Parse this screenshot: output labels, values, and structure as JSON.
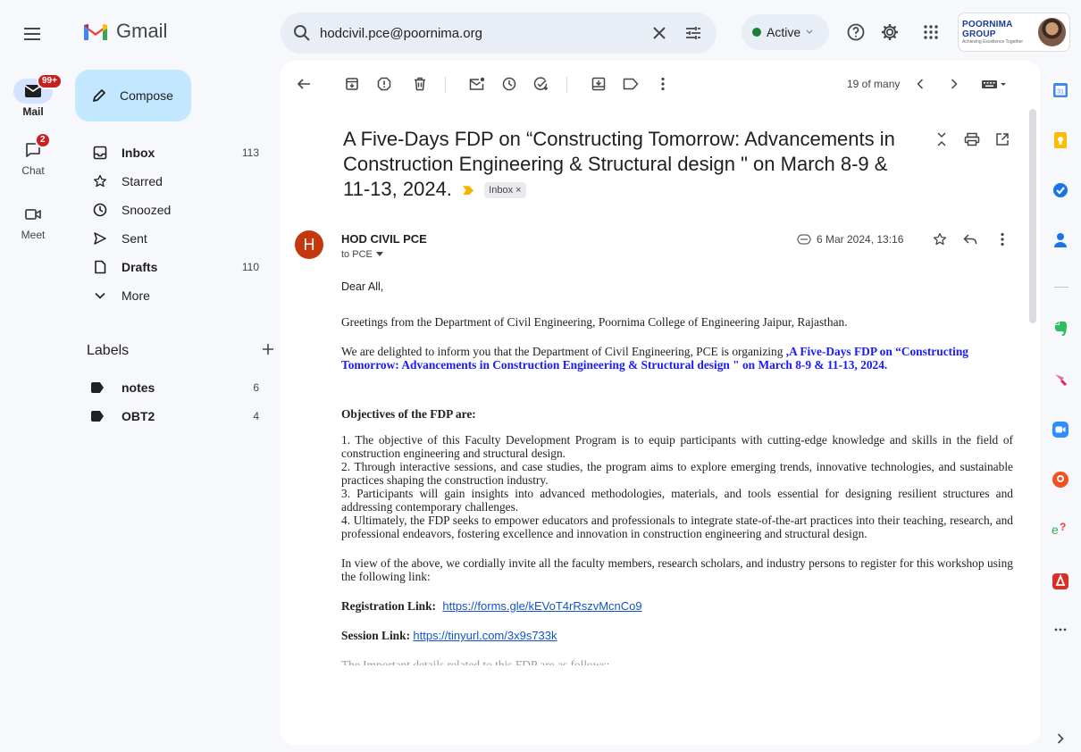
{
  "app": {
    "name": "Gmail",
    "icons": {
      "menu": "hamburger-icon",
      "logo": "gmail-m-logo"
    }
  },
  "rail": {
    "items": [
      {
        "label": "Mail",
        "badge": "99+",
        "icon": "mail-icon"
      },
      {
        "label": "Chat",
        "badge": "2",
        "icon": "chat-icon"
      },
      {
        "label": "Meet",
        "badge": "",
        "icon": "video-icon"
      }
    ]
  },
  "search": {
    "value": "hodcivil.pce@poornima.org",
    "icons": [
      "search-icon",
      "clear-icon",
      "filter-icon"
    ]
  },
  "status": {
    "label": "Active"
  },
  "account": {
    "brand": "POORNIMA GROUP",
    "tagline": "Achieving Excellence Together"
  },
  "compose": {
    "label": "Compose"
  },
  "nav": {
    "items": [
      {
        "label": "Inbox",
        "count": "113",
        "bold": true,
        "icon": "inbox-icon"
      },
      {
        "label": "Starred",
        "count": "",
        "bold": false,
        "icon": "star-icon"
      },
      {
        "label": "Snoozed",
        "count": "",
        "bold": false,
        "icon": "clock-icon"
      },
      {
        "label": "Sent",
        "count": "",
        "bold": false,
        "icon": "send-icon"
      },
      {
        "label": "Drafts",
        "count": "110",
        "bold": true,
        "icon": "draft-icon"
      },
      {
        "label": "More",
        "count": "",
        "bold": false,
        "icon": "chevron-down-icon"
      }
    ]
  },
  "labels": {
    "title": "Labels",
    "items": [
      {
        "label": "notes",
        "count": "6"
      },
      {
        "label": "OBT2",
        "count": "4"
      }
    ]
  },
  "toolbar": {
    "pager": "19 of many"
  },
  "email": {
    "subject": "A Five-Days FDP on “Constructing Tomorrow: Advancements in Construction Engineering & Structural design \" on March 8-9 & 11-13, 2024.",
    "inbox_chip": "Inbox ×",
    "sender_initial": "H",
    "sender": "HOD CIVIL PCE",
    "to": "to PCE",
    "date": "6 Mar 2024, 13:16",
    "body": {
      "greeting": "Dear All,",
      "p1": "Greetings from the Department of Civil Engineering, Poornima College of Engineering Jaipur, Rajasthan.",
      "p2_intro": "We are delighted to inform you that the Department of Civil Engineering, PCE is organizing ",
      "p2_highlight": ",A Five-Days FDP on “Constructing Tomorrow: Advancements in Construction Engineering & Structural design \" on March 8-9 & 11-13, 2024.",
      "objectives_title": "Objectives of the FDP are:",
      "objectives": [
        "1. The objective of this Faculty Development Program is to equip participants with cutting-edge knowledge and skills in the field of construction engineering and structural design.",
        "2. Through interactive sessions, and case studies, the program aims to explore emerging trends, innovative technologies, and sustainable practices shaping the construction industry.",
        "3. Participants will gain insights into advanced methodologies, materials, and tools essential for designing resilient structures and addressing contemporary challenges.",
        "4. Ultimately, the FDP seeks to empower educators and professionals to integrate state-of-the-art practices into their teaching, research, and professional endeavors, fostering excellence and innovation in construction engineering and structural design."
      ],
      "invite": "In view of the above, we cordially invite all the faculty members, research scholars, and industry persons to register for this workshop using the following link:",
      "registration_label": "Registration Link:",
      "registration_url": "https://forms.gle/kEVoT4rRszvMcnCo9",
      "session_label": "Session Link:",
      "session_url": "https://tinyurl.com/3x9s733k",
      "cut_line": "The Important details related to this FDP are as follows:"
    }
  },
  "colors": {
    "background": "#f6f8fc",
    "compose": "#c2e7ff",
    "highlight": "#1a1aff",
    "link": "#1155cc",
    "badge": "#c5221f",
    "sender_avatar": "#c5380f"
  }
}
